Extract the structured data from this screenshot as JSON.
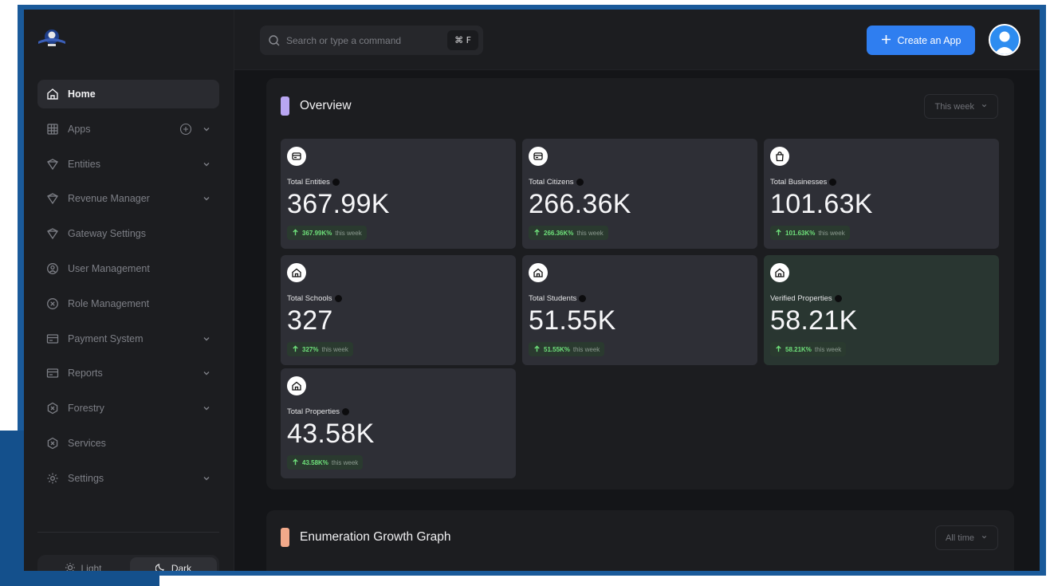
{
  "search": {
    "placeholder": "Search or type a command",
    "shortcut": "⌘ F"
  },
  "header": {
    "create_label": "Create an App"
  },
  "sidebar": {
    "items": [
      {
        "label": "Home",
        "icon": "home-icon"
      },
      {
        "label": "Apps",
        "icon": "grid-icon"
      },
      {
        "label": "Entities",
        "icon": "shield-icon"
      },
      {
        "label": "Revenue Manager",
        "icon": "shield-icon"
      },
      {
        "label": "Gateway Settings",
        "icon": "shield-icon"
      },
      {
        "label": "User Management",
        "icon": "user-circle-icon"
      },
      {
        "label": "Role Management",
        "icon": "x-circle-icon"
      },
      {
        "label": "Payment System",
        "icon": "card-icon"
      },
      {
        "label": "Reports",
        "icon": "card-icon"
      },
      {
        "label": "Forestry",
        "icon": "gear-x-icon"
      },
      {
        "label": "Services",
        "icon": "gear-x-icon"
      },
      {
        "label": "Settings",
        "icon": "gear-icon"
      }
    ],
    "theme": {
      "light": "Light",
      "dark": "Dark"
    }
  },
  "overview": {
    "title": "Overview",
    "period": "This week",
    "cards": [
      {
        "label": "Total Entities",
        "value": "367.99K",
        "delta": "367.99K%",
        "suffix": "this week"
      },
      {
        "label": "Total Citizens",
        "value": "266.36K",
        "delta": "266.36K%",
        "suffix": "this week"
      },
      {
        "label": "Total Businesses",
        "value": "101.63K",
        "delta": "101.63K%",
        "suffix": "this week"
      },
      {
        "label": "Total Schools",
        "value": "327",
        "delta": "327%",
        "suffix": "this week"
      },
      {
        "label": "Total Students",
        "value": "51.55K",
        "delta": "51.55K%",
        "suffix": "this week"
      },
      {
        "label": "Verified Properties",
        "value": "58.21K",
        "delta": "58.21K%",
        "suffix": "this week"
      },
      {
        "label": "Total Properties",
        "value": "43.58K",
        "delta": "43.58K%",
        "suffix": "this week"
      }
    ]
  },
  "growth": {
    "title": "Enumeration Growth Graph",
    "period": "All time"
  },
  "colors": {
    "accent_blue": "#2f7ef0",
    "overview_accent": "#b9a6f2",
    "growth_accent": "#f2a98a",
    "positive": "#6ee07a"
  }
}
